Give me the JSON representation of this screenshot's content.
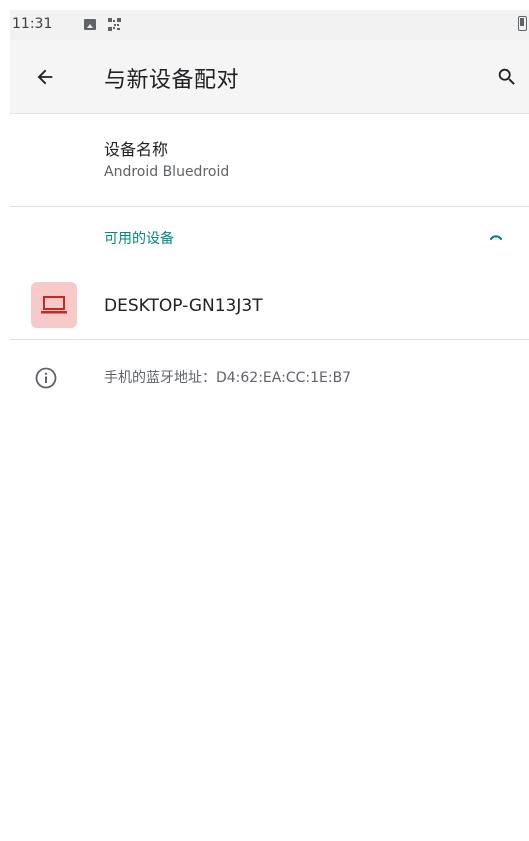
{
  "status_bar": {
    "time": "11:31"
  },
  "app_bar": {
    "title": "与新设备配对",
    "back_icon": "arrow-back-icon",
    "search_icon": "search-icon"
  },
  "device_name": {
    "title": "设备名称",
    "value": "Android Bluedroid"
  },
  "available": {
    "header": "可用的设备",
    "devices": [
      {
        "name": "DESKTOP-GN13J3T",
        "icon": "laptop-icon"
      }
    ]
  },
  "info": {
    "text": "手机的蓝牙地址：D4:62:EA:CC:1E:B7",
    "icon": "info-icon"
  },
  "colors": {
    "accent": "#00897b",
    "device_icon_bg": "#f8c9c9",
    "device_icon_fg": "#c62828"
  }
}
